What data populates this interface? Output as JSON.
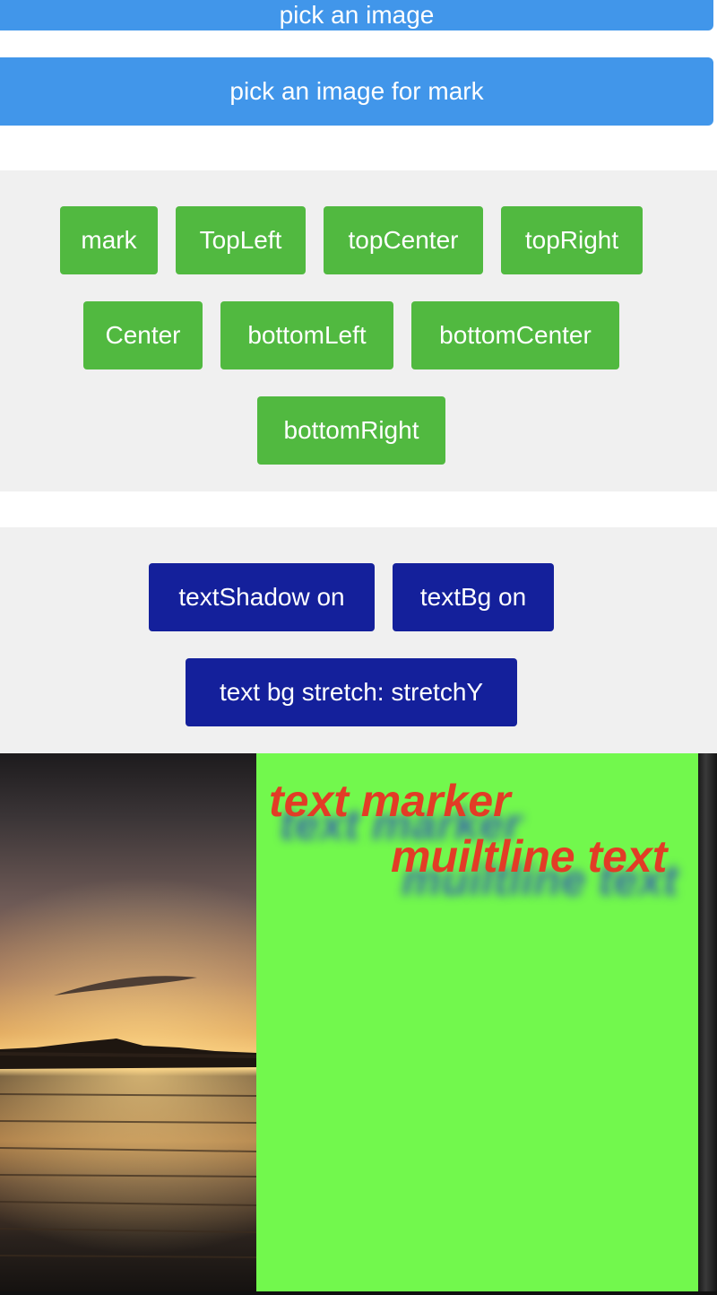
{
  "buttons": {
    "top_partial_label": "pick an image",
    "pick_image_label": "pick an image for mark"
  },
  "mark_positions": {
    "items": [
      {
        "label": "mark"
      },
      {
        "label": "TopLeft"
      },
      {
        "label": "topCenter"
      },
      {
        "label": "topRight"
      },
      {
        "label": "Center"
      },
      {
        "label": "bottomLeft"
      },
      {
        "label": "bottomCenter"
      },
      {
        "label": "bottomRight"
      }
    ]
  },
  "text_options": {
    "text_shadow_label": "textShadow on",
    "text_bg_label": "textBg on",
    "stretch_label": "text bg stretch: stretchY"
  },
  "preview": {
    "text_line_1": "text marker",
    "text_line_2": "muiltline text"
  },
  "colors": {
    "primary_blue": "#4196ea",
    "green_button": "#51b940",
    "navy_button": "#14209b",
    "panel_bg": "#f0f0f0",
    "mark_text": "#e23c26",
    "text_bg_green": "#72f84d",
    "text_shadow": "#283cc8"
  }
}
